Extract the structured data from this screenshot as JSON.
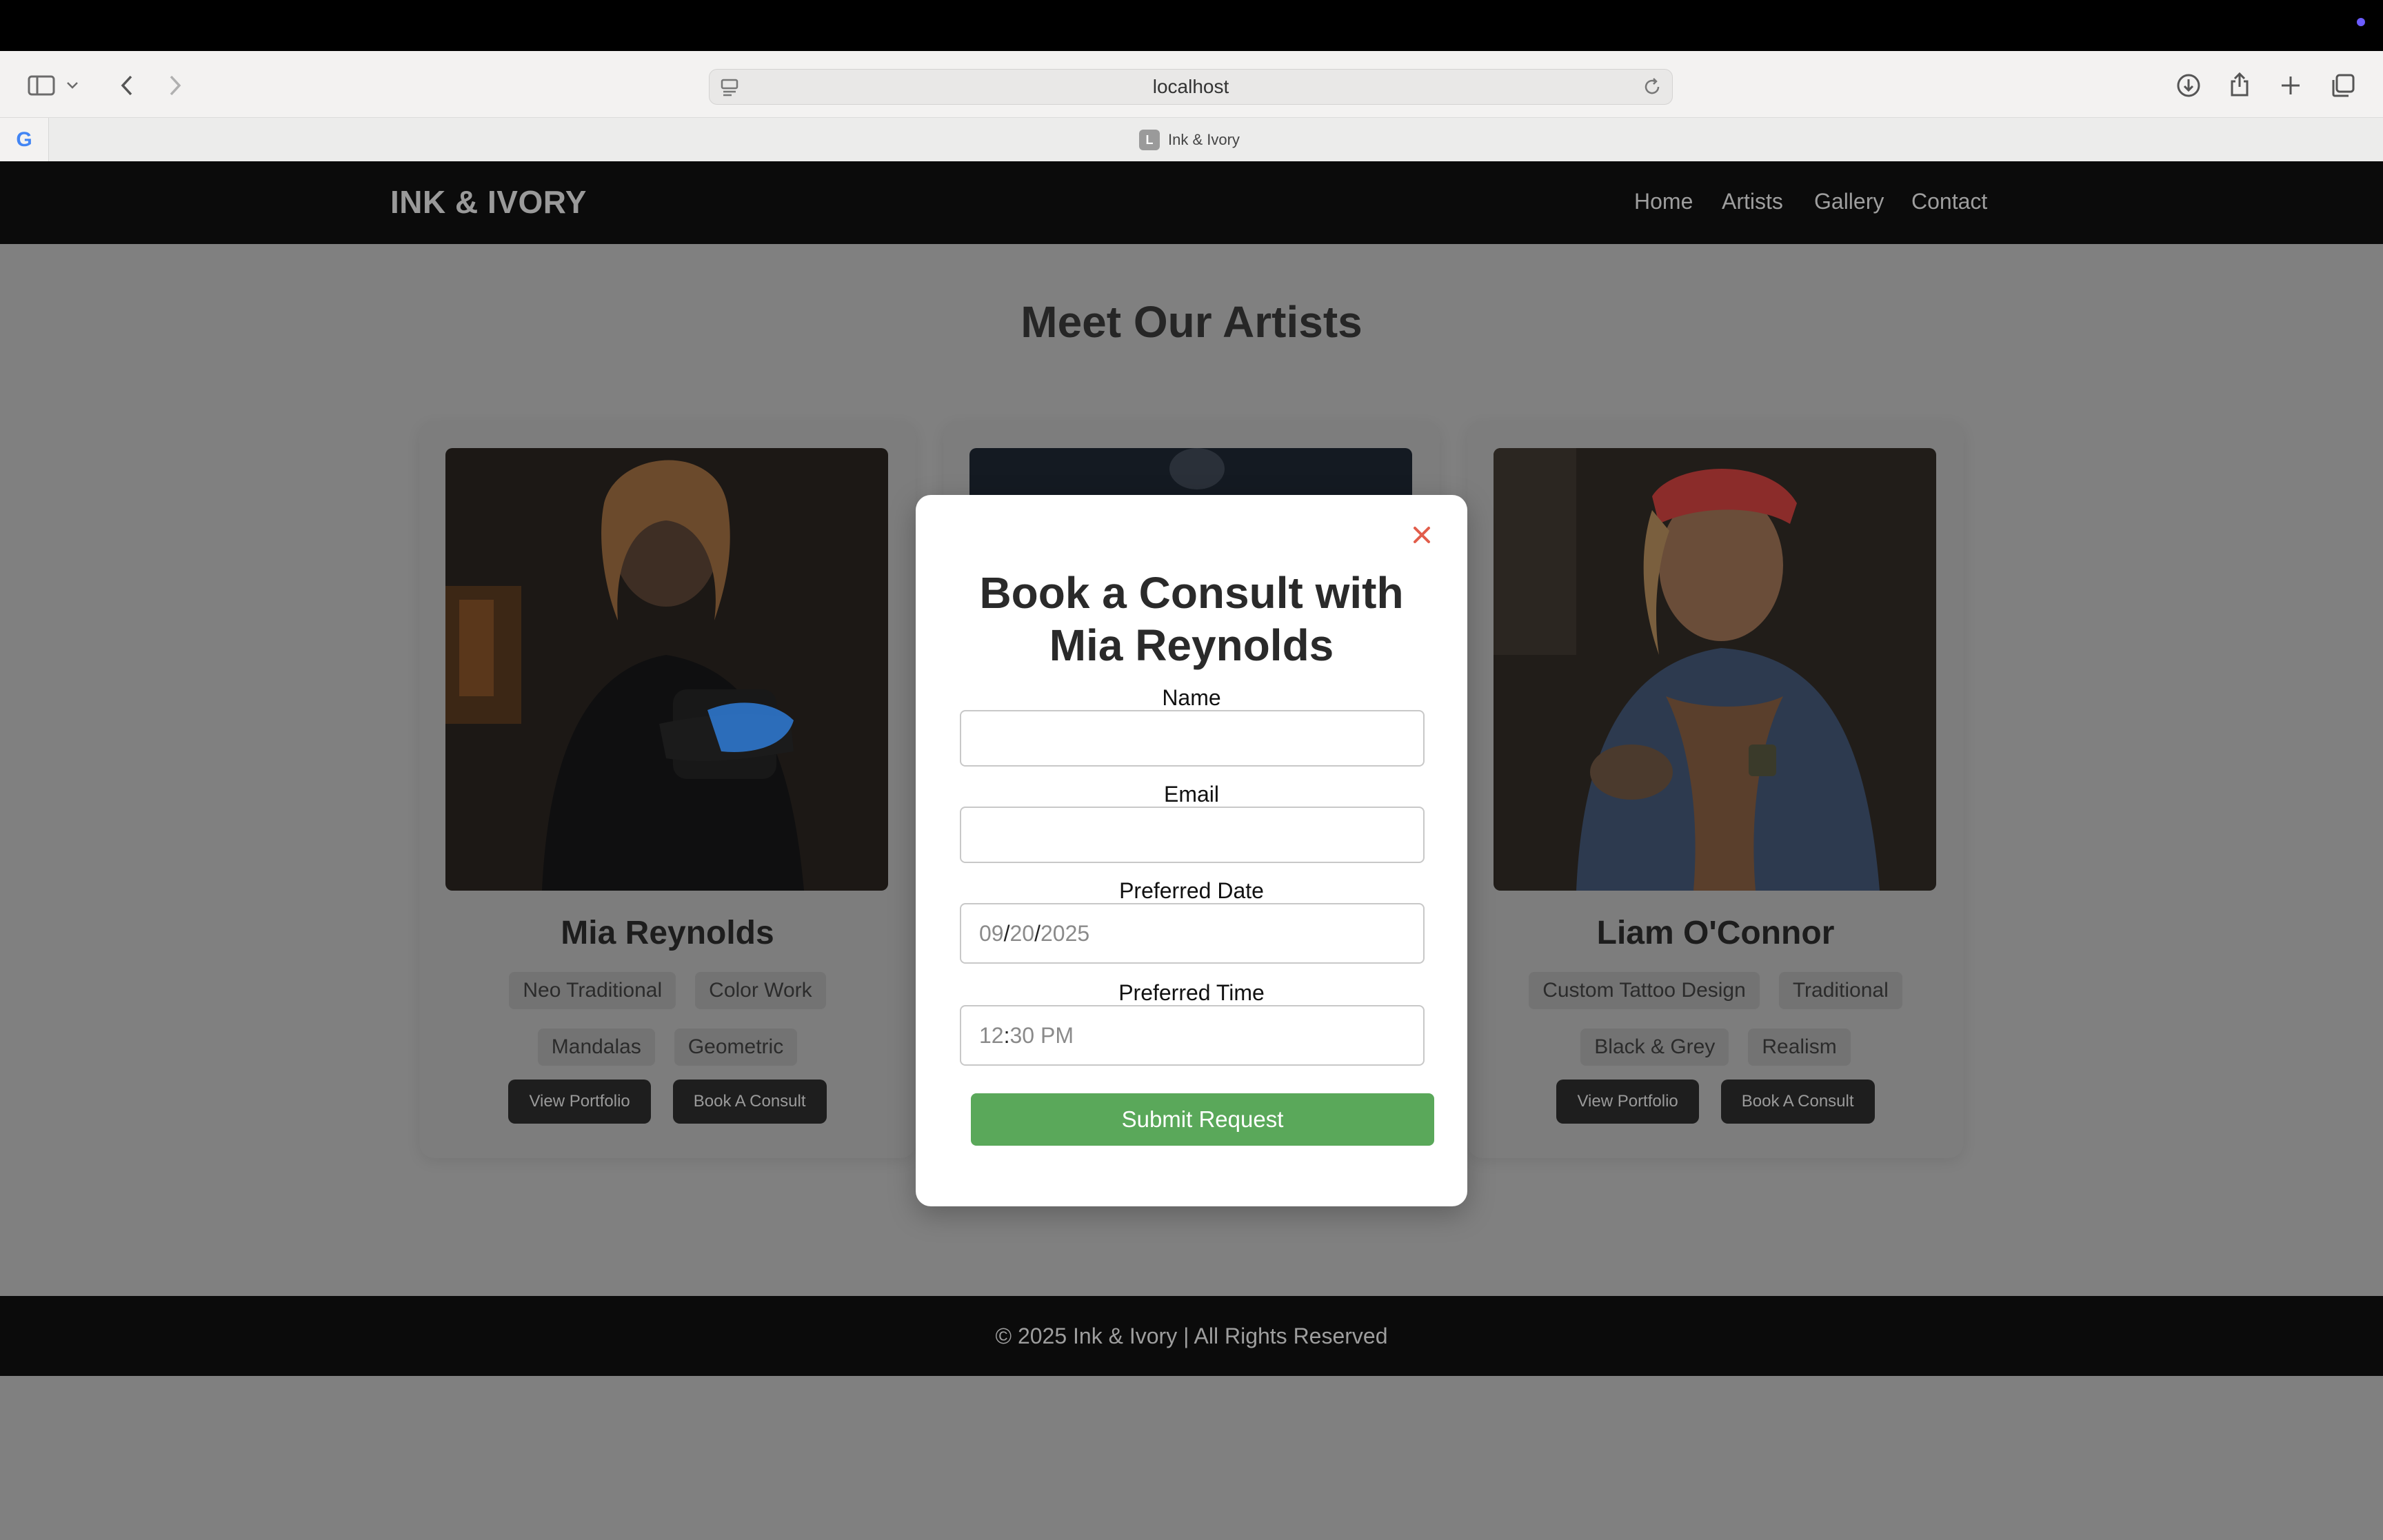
{
  "browser": {
    "url": "localhost",
    "tab_title": "Ink & Ivory",
    "tab_favicon_letter": "L",
    "google_favicon_letter": "G"
  },
  "site": {
    "logo": "INK & IVORY",
    "nav": [
      "Home",
      "Artists",
      "Gallery",
      "Contact"
    ],
    "heading": "Meet Our Artists",
    "footer": "© 2025 Ink & Ivory | All Rights Reserved"
  },
  "artists": [
    {
      "name": "Mia Reynolds",
      "tags_row1": [
        "Neo Traditional",
        "Color Work"
      ],
      "tags_row2": [
        "Mandalas",
        "Geometric"
      ],
      "portfolio_label": "View Portfolio",
      "consult_label": "Book A Consult"
    },
    {
      "name": "Liam O'Connor",
      "tags_row1": [
        "Custom Tattoo Design",
        "Traditional"
      ],
      "tags_row2": [
        "Black & Grey",
        "Realism"
      ],
      "portfolio_label": "View Portfolio",
      "consult_label": "Book A Consult"
    }
  ],
  "modal": {
    "title_line1": "Book a Consult with",
    "title_line2": "Mia Reynolds",
    "name_label": "Name",
    "name_value": "",
    "email_label": "Email",
    "email_value": "",
    "date_label": "Preferred Date",
    "date_month": "09",
    "date_day": "20",
    "date_year": "2025",
    "time_label": "Preferred Time",
    "time_hour": "12",
    "time_minute": "30",
    "time_ampm": "PM",
    "submit_label": "Submit Request"
  },
  "colors": {
    "submit": "#5aa85a",
    "close": "#e25d4b",
    "overlay": "#808080"
  }
}
